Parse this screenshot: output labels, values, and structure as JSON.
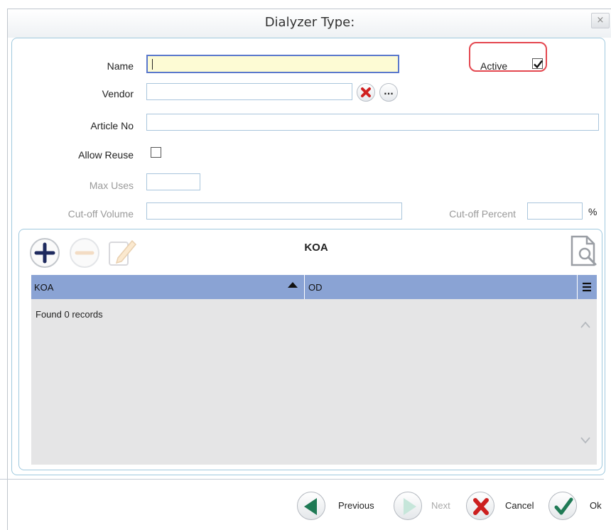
{
  "window": {
    "title": "Dialyzer Type:",
    "close_glyph": "×"
  },
  "form": {
    "name_label": "Name",
    "name_value": "",
    "vendor_label": "Vendor",
    "vendor_value": "",
    "vendor_browse": "...",
    "article_label": "Article No",
    "article_value": "",
    "allow_reuse_label": "Allow Reuse",
    "allow_reuse_checked": false,
    "max_uses_label": "Max Uses",
    "max_uses_value": "",
    "cutoff_volume_label": "Cut-off Volume",
    "cutoff_volume_value": "",
    "cutoff_percent_label": "Cut-off Percent",
    "cutoff_percent_value": "",
    "percent_sign": "%",
    "active_label": "Active",
    "active_checked": true
  },
  "koa": {
    "title": "KOA",
    "columns": [
      "KOA",
      "OD"
    ],
    "sorted_column": "KOA",
    "status": "Found 0 records",
    "rows": []
  },
  "footer": {
    "previous_label": "Previous",
    "next_label": "Next",
    "cancel_label": "Cancel",
    "ok_label": "Ok"
  },
  "colors": {
    "highlight_border": "#e4474f",
    "grid_header": "#8aa3d4",
    "focus_field": "#fdfbd4"
  }
}
